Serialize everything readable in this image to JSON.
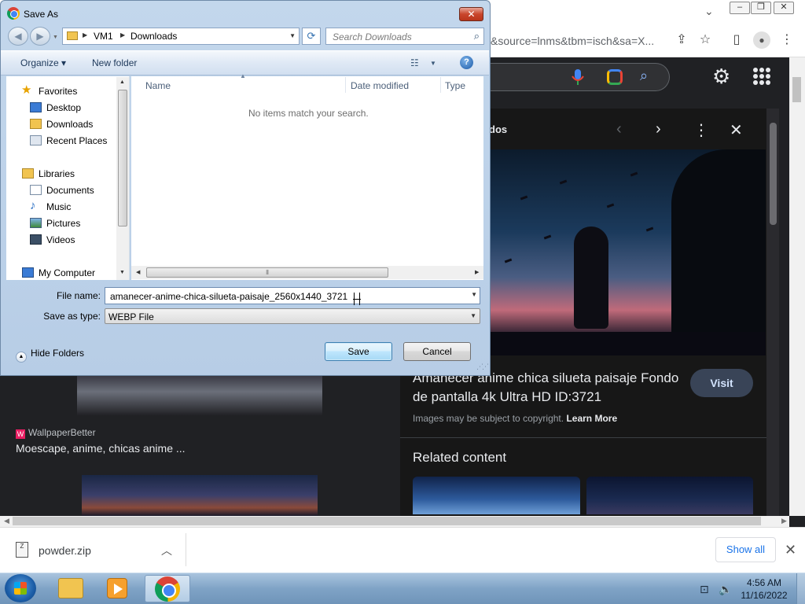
{
  "browser": {
    "url_fragment": "&source=lnms&tbm=isch&sa=X...",
    "win_controls": [
      "–",
      "❐",
      "✕"
    ]
  },
  "google": {
    "panel_heading_fragment": "dos",
    "image_title": "Amanecer anime chica silueta paisaje Fondo de pantalla 4k Ultra HD ID:3721",
    "visit_label": "Visit",
    "copyright_text": "Images may be subject to copyright.",
    "learn_more": "Learn More",
    "related_heading": "Related content",
    "left_result": {
      "source": "WallpaperBetter",
      "title": "Moescape, anime, chicas anime ..."
    }
  },
  "downloads": {
    "file_name": "powder.zip",
    "show_all": "Show all"
  },
  "taskbar": {
    "time": "4:56 AM",
    "date": "11/16/2022"
  },
  "dialog": {
    "title": "Save As",
    "path": [
      "VM1",
      "Downloads"
    ],
    "search_placeholder": "Search Downloads",
    "organize_label": "Organize",
    "new_folder_label": "New folder",
    "nav": {
      "favorites": "Favorites",
      "desktop": "Desktop",
      "downloads": "Downloads",
      "recent": "Recent Places",
      "libraries": "Libraries",
      "documents": "Documents",
      "music": "Music",
      "pictures": "Pictures",
      "videos": "Videos",
      "computer": "My Computer"
    },
    "columns": [
      "Name",
      "Date modified",
      "Type"
    ],
    "empty_message": "No items match your search.",
    "file_name_label": "File name:",
    "file_name_value": "amanecer-anime-chica-silueta-paisaje_2560x1440_3721",
    "save_type_label": "Save as type:",
    "save_type_value": "WEBP File",
    "hide_folders": "Hide Folders",
    "save_button": "Save",
    "cancel_button": "Cancel"
  },
  "colors": {
    "dialog_frame": "#b7cde6",
    "google_bg": "#202124",
    "visit_bg": "#394457",
    "link_blue": "#1a73e8"
  }
}
